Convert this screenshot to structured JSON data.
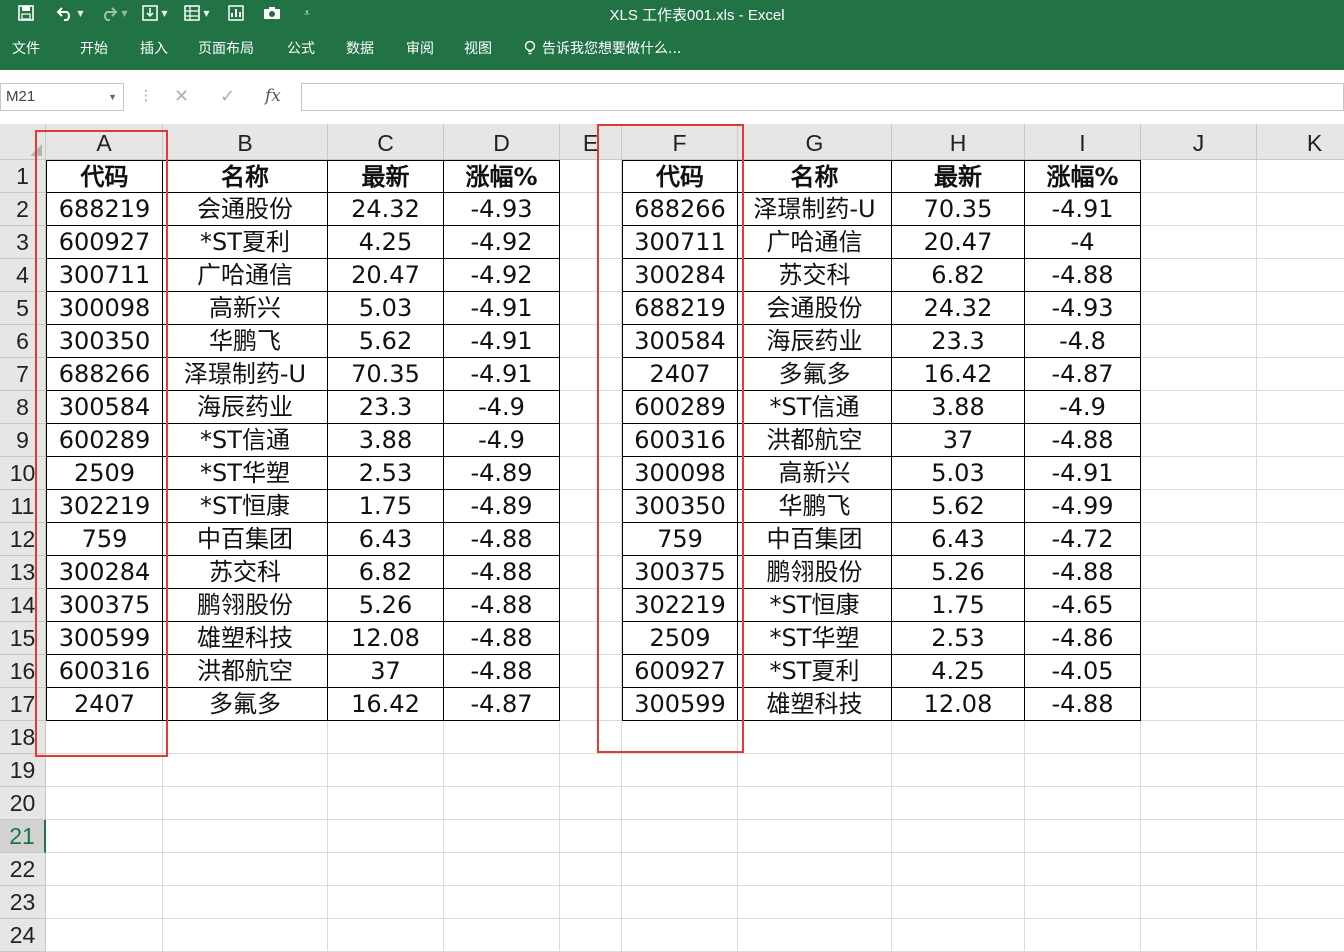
{
  "window": {
    "title": "XLS 工作表001.xls - Excel"
  },
  "ribbon": {
    "tabs": [
      "文件",
      "开始",
      "插入",
      "页面布局",
      "公式",
      "数据",
      "审阅",
      "视图"
    ],
    "tell_me": "告诉我您想要做什么..."
  },
  "formula_bar": {
    "name_box": "M21",
    "fx_label": "fx",
    "formula": ""
  },
  "grid": {
    "columns": [
      "A",
      "B",
      "C",
      "D",
      "E",
      "F",
      "G",
      "H",
      "I",
      "J",
      "K"
    ],
    "rows": [
      "1",
      "2",
      "3",
      "4",
      "5",
      "6",
      "7",
      "8",
      "9",
      "10",
      "11",
      "12",
      "13",
      "14",
      "15",
      "16",
      "17",
      "18",
      "19",
      "20",
      "21",
      "22",
      "23",
      "24"
    ],
    "selected_row": "21"
  },
  "table_left": {
    "headers": [
      "代码",
      "名称",
      "最新",
      "涨幅%"
    ],
    "rows": [
      [
        "688219",
        "会通股份",
        "24.32",
        "-4.93"
      ],
      [
        "600927",
        "*ST夏利",
        "4.25",
        "-4.92"
      ],
      [
        "300711",
        "广哈通信",
        "20.47",
        "-4.92"
      ],
      [
        "300098",
        "高新兴",
        "5.03",
        "-4.91"
      ],
      [
        "300350",
        "华鹏飞",
        "5.62",
        "-4.91"
      ],
      [
        "688266",
        "泽璟制药-U",
        "70.35",
        "-4.91"
      ],
      [
        "300584",
        "海辰药业",
        "23.3",
        "-4.9"
      ],
      [
        "600289",
        "*ST信通",
        "3.88",
        "-4.9"
      ],
      [
        "2509",
        "*ST华塑",
        "2.53",
        "-4.89"
      ],
      [
        "302219",
        "*ST恒康",
        "1.75",
        "-4.89"
      ],
      [
        "759",
        "中百集团",
        "6.43",
        "-4.88"
      ],
      [
        "300284",
        "苏交科",
        "6.82",
        "-4.88"
      ],
      [
        "300375",
        "鹏翎股份",
        "5.26",
        "-4.88"
      ],
      [
        "300599",
        "雄塑科技",
        "12.08",
        "-4.88"
      ],
      [
        "600316",
        "洪都航空",
        "37",
        "-4.88"
      ],
      [
        "2407",
        "多氟多",
        "16.42",
        "-4.87"
      ]
    ]
  },
  "table_right": {
    "headers": [
      "代码",
      "名称",
      "最新",
      "涨幅%"
    ],
    "rows": [
      [
        "688266",
        "泽璟制药-U",
        "70.35",
        "-4.91"
      ],
      [
        "300711",
        "广哈通信",
        "20.47",
        "-4"
      ],
      [
        "300284",
        "苏交科",
        "6.82",
        "-4.88"
      ],
      [
        "688219",
        "会通股份",
        "24.32",
        "-4.93"
      ],
      [
        "300584",
        "海辰药业",
        "23.3",
        "-4.8"
      ],
      [
        "2407",
        "多氟多",
        "16.42",
        "-4.87"
      ],
      [
        "600289",
        "*ST信通",
        "3.88",
        "-4.9"
      ],
      [
        "600316",
        "洪都航空",
        "37",
        "-4.88"
      ],
      [
        "300098",
        "高新兴",
        "5.03",
        "-4.91"
      ],
      [
        "300350",
        "华鹏飞",
        "5.62",
        "-4.99"
      ],
      [
        "759",
        "中百集团",
        "6.43",
        "-4.72"
      ],
      [
        "300375",
        "鹏翎股份",
        "5.26",
        "-4.88"
      ],
      [
        "302219",
        "*ST恒康",
        "1.75",
        "-4.65"
      ],
      [
        "2509",
        "*ST华塑",
        "2.53",
        "-4.86"
      ],
      [
        "600927",
        "*ST夏利",
        "4.25",
        "-4.05"
      ],
      [
        "300599",
        "雄塑科技",
        "12.08",
        "-4.88"
      ]
    ]
  },
  "colors": {
    "excel_green": "#217346",
    "highlight_red": "#e53935"
  }
}
